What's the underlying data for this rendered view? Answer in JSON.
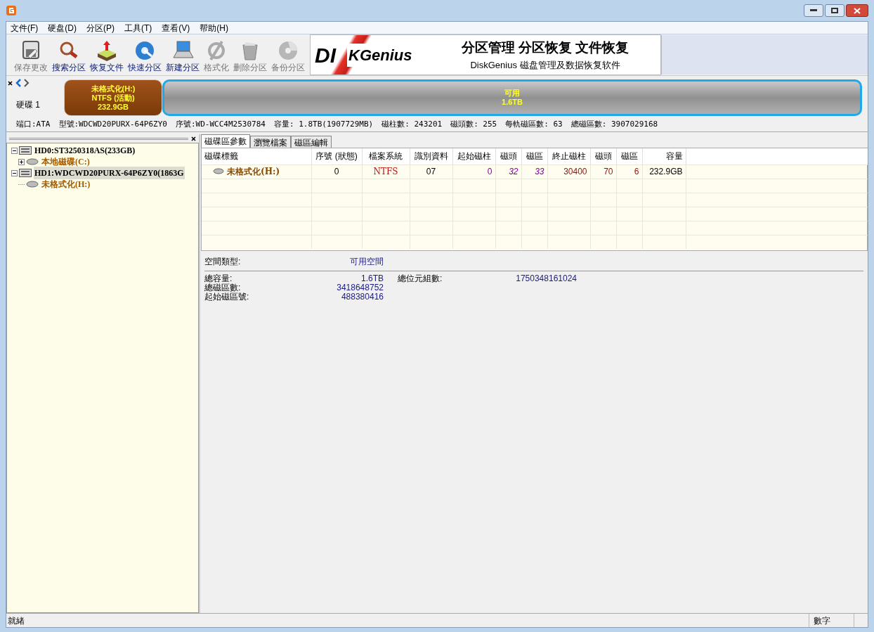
{
  "menu": [
    "文件(F)",
    "硬盘(D)",
    "分区(P)",
    "工具(T)",
    "查看(V)",
    "帮助(H)"
  ],
  "toolbar": [
    {
      "label": "保存更改",
      "disabled": true
    },
    {
      "label": "搜索分区",
      "disabled": false
    },
    {
      "label": "恢复文件",
      "disabled": false
    },
    {
      "label": "快速分区",
      "disabled": false
    },
    {
      "label": "新建分区",
      "disabled": false
    },
    {
      "label": "格式化",
      "disabled": true
    },
    {
      "label": "删除分区",
      "disabled": true
    },
    {
      "label": "备份分区",
      "disabled": true
    }
  ],
  "banner": {
    "logo_left": "DI",
    "logo_right": "KGenius",
    "headline": "分区管理 分区恢复 文件恢复",
    "subline": "DiskGenius 磁盘管理及数据恢复软件"
  },
  "disk_map": {
    "disk_label": "硬碟 1",
    "partitions": [
      {
        "kind": "partition",
        "selected": false,
        "lines": [
          "未格式化(H:)",
          "NTFS (活動)",
          "232.9GB"
        ]
      },
      {
        "kind": "free",
        "selected": true,
        "lines": [
          "可用",
          "1.6TB"
        ]
      }
    ]
  },
  "disk_info": [
    "端口:ATA",
    "型號:WDCWD20PURX-64P6ZY0",
    "序號:WD-WCC4M2530784",
    "容量: 1.8TB(1907729MB)",
    "磁柱數: 243201",
    "磁頭數: 255",
    "每軌磁區數: 63",
    "總磁區數: 3907029168"
  ],
  "tree": [
    {
      "label": "HD0:ST3250318AS(233GB)",
      "kind": "disk",
      "expanded": true,
      "selected": false,
      "children": [
        {
          "label": "本地磁碟(C:)",
          "kind": "partition",
          "expanded": false,
          "selected": false
        }
      ]
    },
    {
      "label": "HD1:WDCWD20PURX-64P6ZY0(1863G",
      "kind": "disk",
      "expanded": true,
      "selected": true,
      "children": [
        {
          "label": "未格式化(H:)",
          "kind": "partition",
          "selected": false
        }
      ]
    }
  ],
  "tabs": [
    {
      "label": "磁碟區參數",
      "selected": true
    },
    {
      "label": "瀏覽檔案",
      "selected": false
    },
    {
      "label": "磁區編輯",
      "selected": false
    }
  ],
  "table": {
    "columns": [
      "磁碟標籤",
      "序號 (狀態)",
      "檔案系統",
      "識別資料",
      "起始磁柱",
      "磁頭",
      "磁區",
      "終止磁柱",
      "磁頭",
      "磁區",
      "容量"
    ],
    "rows": [
      [
        "未格式化(H:)",
        "0",
        "NTFS",
        "07",
        "0",
        "32",
        "33",
        "30400",
        "70",
        "6",
        "232.9GB"
      ]
    ]
  },
  "details": {
    "type_label": "空間類型:",
    "type_value": "可用空間",
    "fields": [
      {
        "label": "總容量:",
        "value": "1.6TB"
      },
      {
        "label": "總磁區數:",
        "value": "3418648752"
      },
      {
        "label": "起始磁區號:",
        "value": "488380416"
      }
    ],
    "side_fields": [
      {
        "label": "總位元組數:",
        "value": "1750348161024"
      }
    ]
  },
  "status_bar": [
    "就緒",
    "數字"
  ]
}
